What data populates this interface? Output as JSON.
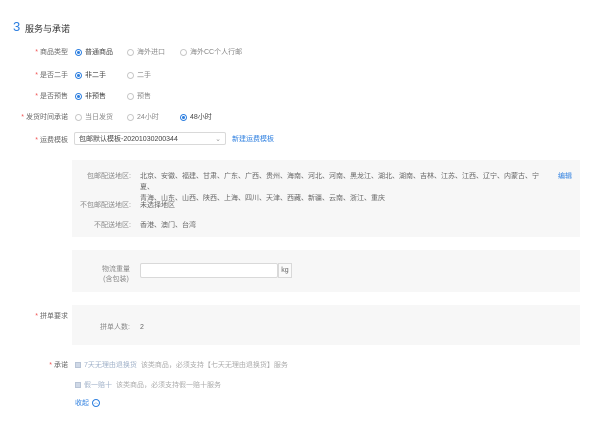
{
  "section": {
    "number": "3",
    "title": "服务与承诺"
  },
  "product_type": {
    "label": "商品类型",
    "options": [
      "普通商品",
      "海外进口",
      "海外CC个人行邮"
    ],
    "selected": 0
  },
  "second_hand": {
    "label": "是否二手",
    "options": [
      "非二手",
      "二手"
    ],
    "selected": 0
  },
  "presale": {
    "label": "是否预售",
    "options": [
      "非预售",
      "预售"
    ],
    "selected": 0
  },
  "ship_time": {
    "label": "发货时间承诺",
    "options": [
      "当日发货",
      "24小时",
      "48小时"
    ],
    "selected": 2
  },
  "freight": {
    "label": "运费模板",
    "selected_value": "包邮默认模板-20201030200344",
    "new_link": "新建运费模板",
    "shipping_areas_label": "包邮配送地区:",
    "shipping_areas_line1": "北京、安徽、福建、甘肃、广东、广西、贵州、海南、河北、河南、黑龙江、湖北、湖南、吉林、江苏、江西、辽宁、内蒙古、宁夏、",
    "shipping_areas_line2": "青海、山东、山西、陕西、上海、四川、天津、西藏、新疆、云南、浙江、重庆",
    "edit_link": "编辑",
    "not_free_label": "不包邮配送地区:",
    "not_free_value": "未选择地区",
    "not_delivered_label": "不配送地区:",
    "not_delivered_value": "香港、澳门、台湾"
  },
  "weight": {
    "label_line1": "物流重量",
    "label_line2": "(含包装)",
    "value": "",
    "unit": "kg"
  },
  "group_buy": {
    "label": "拼单要求",
    "count_label": "拼单人数:",
    "count_value": "2"
  },
  "promise": {
    "label": "承诺",
    "opt1_tag": "7天无理由退换货",
    "opt1_desc": "该类商品，必须支持【七天无理由退换货】服务",
    "opt2_tag": "假一赔十",
    "opt2_desc": "该类商品，必须支持假一赔十服务"
  },
  "collapse": {
    "label": "收起"
  },
  "colors": {
    "accent": "#2d7fe0",
    "required": "#f04b4b",
    "panel": "#f7f7f7"
  }
}
